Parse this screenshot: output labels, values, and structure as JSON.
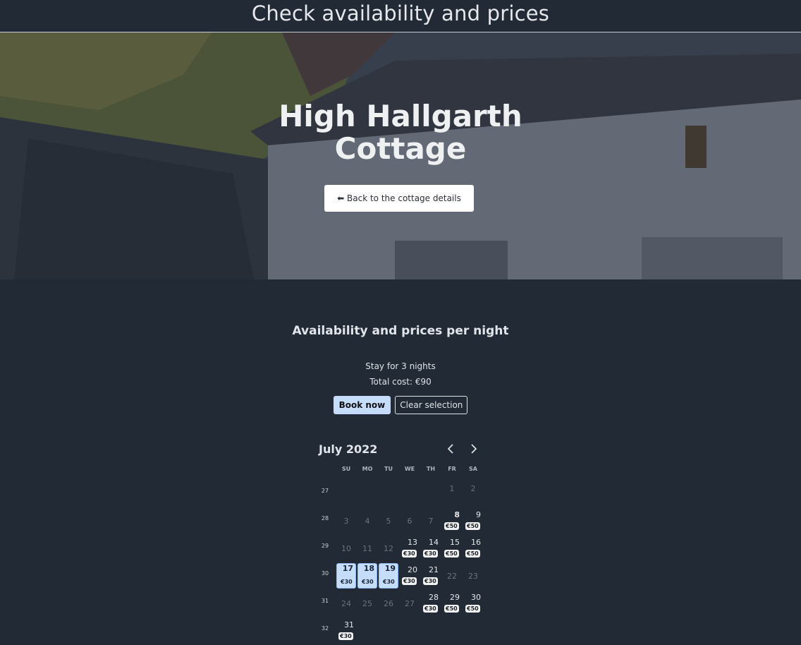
{
  "header": {
    "title": "Check availability and prices"
  },
  "hero": {
    "title_line1": "High Hallgarth",
    "title_line2": "Cottage",
    "back_button_label": "⬅ Back to the cottage details"
  },
  "booking": {
    "heading": "Availability and prices per night",
    "stay_text": "Stay for 3 nights",
    "total_text": "Total cost: €90",
    "book_label": "Book now",
    "clear_label": "Clear selection"
  },
  "calendar": {
    "month_label": "July 2022",
    "weekdays": [
      "SU",
      "MO",
      "TU",
      "WE",
      "TH",
      "FR",
      "SA"
    ],
    "weeks": [
      {
        "week": "27",
        "days": [
          null,
          null,
          null,
          null,
          null,
          {
            "d": "1",
            "s": "disabled"
          },
          {
            "d": "2",
            "s": "disabled"
          }
        ]
      },
      {
        "week": "28",
        "days": [
          {
            "d": "3",
            "s": "disabled"
          },
          {
            "d": "4",
            "s": "disabled"
          },
          {
            "d": "5",
            "s": "disabled"
          },
          {
            "d": "6",
            "s": "disabled"
          },
          {
            "d": "7",
            "s": "disabled"
          },
          {
            "d": "8",
            "s": "available",
            "p": "€50",
            "bold": true
          },
          {
            "d": "9",
            "s": "available",
            "p": "€50"
          }
        ]
      },
      {
        "week": "29",
        "days": [
          {
            "d": "10",
            "s": "disabled"
          },
          {
            "d": "11",
            "s": "disabled"
          },
          {
            "d": "12",
            "s": "disabled"
          },
          {
            "d": "13",
            "s": "available",
            "p": "€30"
          },
          {
            "d": "14",
            "s": "available",
            "p": "€30"
          },
          {
            "d": "15",
            "s": "available",
            "p": "€50"
          },
          {
            "d": "16",
            "s": "available",
            "p": "€50"
          }
        ]
      },
      {
        "week": "30",
        "days": [
          {
            "d": "17",
            "s": "selected",
            "p": "€30"
          },
          {
            "d": "18",
            "s": "selected",
            "p": "€30"
          },
          {
            "d": "19",
            "s": "selected",
            "p": "€30"
          },
          {
            "d": "20",
            "s": "available",
            "p": "€30"
          },
          {
            "d": "21",
            "s": "available",
            "p": "€30"
          },
          {
            "d": "22",
            "s": "disabled"
          },
          {
            "d": "23",
            "s": "disabled"
          }
        ]
      },
      {
        "week": "31",
        "days": [
          {
            "d": "24",
            "s": "disabled"
          },
          {
            "d": "25",
            "s": "disabled"
          },
          {
            "d": "26",
            "s": "disabled"
          },
          {
            "d": "27",
            "s": "disabled"
          },
          {
            "d": "28",
            "s": "available",
            "p": "€30"
          },
          {
            "d": "29",
            "s": "available",
            "p": "€50"
          },
          {
            "d": "30",
            "s": "available",
            "p": "€50"
          }
        ]
      },
      {
        "week": "32",
        "days": [
          {
            "d": "31",
            "s": "available",
            "p": "€30"
          },
          null,
          null,
          null,
          null,
          null,
          null
        ]
      }
    ]
  },
  "icons": {
    "prev": "chevron-left-icon",
    "next": "chevron-right-icon"
  }
}
